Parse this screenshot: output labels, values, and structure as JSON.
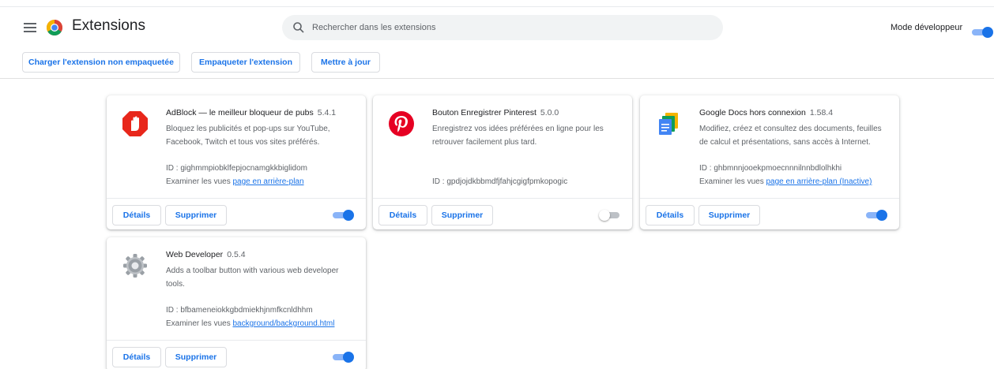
{
  "header": {
    "title": "Extensions",
    "search_placeholder": "Rechercher dans les extensions",
    "devmode_label": "Mode développeur",
    "devmode_on": true
  },
  "toolbar": {
    "load_label": "Charger l'extension non empaquetée",
    "pack_label": "Empaqueter l'extension",
    "update_label": "Mettre à jour"
  },
  "colors": {
    "accent": "#1a73e8",
    "adblock_red": "#e8271b",
    "pinterest_red": "#e60023"
  },
  "extensions": [
    {
      "icon": "adblock-icon",
      "name": "AdBlock — le meilleur bloqueur de pubs",
      "version": "5.4.1",
      "description": "Bloquez les publicités et pop-ups sur YouTube, Facebook, Twitch et tous vos sites préférés.",
      "id": "ID : gighmmpiobklfepjocnamgkkbiglidom",
      "views_label": "Examiner les vues",
      "views_link": "page en arrière-plan",
      "details_label": "Détails",
      "remove_label": "Supprimer",
      "enabled": true
    },
    {
      "icon": "pinterest-icon",
      "name": "Bouton Enregistrer Pinterest",
      "version": "5.0.0",
      "description": "Enregistrez vos idées préférées en ligne pour les retrouver facilement plus tard.",
      "id": "ID : gpdjojdkbbmdfjfahjcgigfpmkopogic",
      "details_label": "Détails",
      "remove_label": "Supprimer",
      "enabled": false
    },
    {
      "icon": "google-docs-icon",
      "name": "Google Docs hors connexion",
      "version": "1.58.4",
      "description": "Modifiez, créez et consultez des documents, feuilles de calcul et présentations, sans accès à Internet.",
      "id": "ID : ghbmnnjooekpmoecnnnilnnbdlolhkhi",
      "views_label": "Examiner les vues",
      "views_link": "page en arrière-plan (Inactive)",
      "details_label": "Détails",
      "remove_label": "Supprimer",
      "enabled": true
    },
    {
      "icon": "gear-icon",
      "name": "Web Developer",
      "version": "0.5.4",
      "description": "Adds a toolbar button with various web developer tools.",
      "id": "ID : bfbameneiokkgbdmiekhjnmfkcnldhhm",
      "views_label": "Examiner les vues",
      "views_link": "background/background.html",
      "details_label": "Détails",
      "remove_label": "Supprimer",
      "enabled": true
    }
  ]
}
